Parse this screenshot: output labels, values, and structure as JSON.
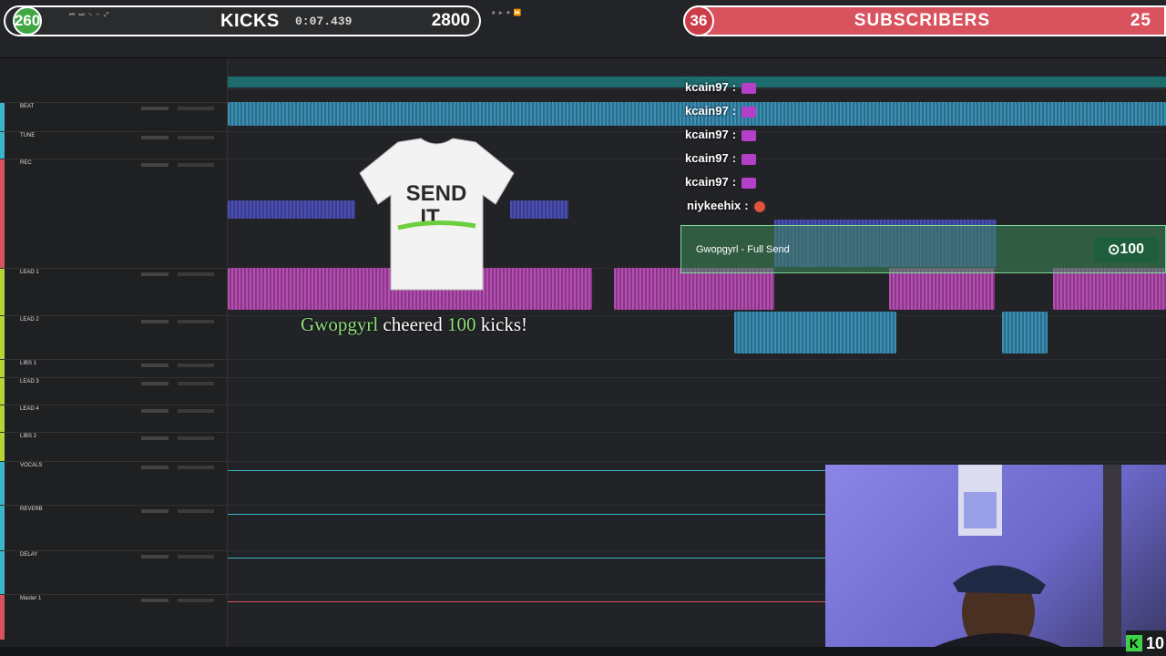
{
  "overlay": {
    "kicks_count": "260",
    "kicks_label": "KICKS",
    "kicks_goal": "2800",
    "subs_count": "36",
    "subs_label": "SUBSCRIBERS",
    "subs_goal": "25"
  },
  "transport": {
    "counter": "0:07.439"
  },
  "tracks": [
    {
      "name": "BEAT",
      "color": "#3bb6c6"
    },
    {
      "name": "TUNE",
      "color": "#3bb6c6"
    },
    {
      "name": "REC",
      "color": "#d9535f"
    },
    {
      "name": "LEAD 1",
      "color": "#b7d437"
    },
    {
      "name": "LEAD 2",
      "color": "#b7d437"
    },
    {
      "name": "LIBS 1",
      "color": "#b7d437"
    },
    {
      "name": "LEAD 3",
      "color": "#b7d437"
    },
    {
      "name": "LEAD 4",
      "color": "#b7d437"
    },
    {
      "name": "LIBS 2",
      "color": "#b7d437"
    },
    {
      "name": "VOCALS",
      "color": "#3bb6c6"
    },
    {
      "name": "REVERB",
      "color": "#3bb6c6"
    },
    {
      "name": "DELAY",
      "color": "#3bb6c6"
    },
    {
      "name": "Master 1",
      "color": "#d9535f"
    }
  ],
  "chat": [
    {
      "user": "kcain97",
      "sep": ":"
    },
    {
      "user": "kcain97",
      "sep": ":"
    },
    {
      "user": "kcain97",
      "sep": ":"
    },
    {
      "user": "kcain97",
      "sep": ":"
    },
    {
      "user": "kcain97",
      "sep": ":"
    },
    {
      "user": "niykeehix",
      "sep": ":"
    }
  ],
  "alert": {
    "user": "Gwopgyrl",
    "item": "- Full Send",
    "amount": "100"
  },
  "cheer": {
    "user": "Gwopgyrl",
    "verb": "cheered",
    "amount": "100",
    "unit": "kicks!"
  },
  "shirt": {
    "line1": "SEND",
    "line2": "IT"
  },
  "badge": {
    "icon": "K",
    "value": "10"
  },
  "colors": {
    "kicks_green": "#3fa844",
    "subs_red": "#d9535f",
    "wave_blue": "#3b8fb4",
    "wave_pink": "#b44fb0"
  }
}
